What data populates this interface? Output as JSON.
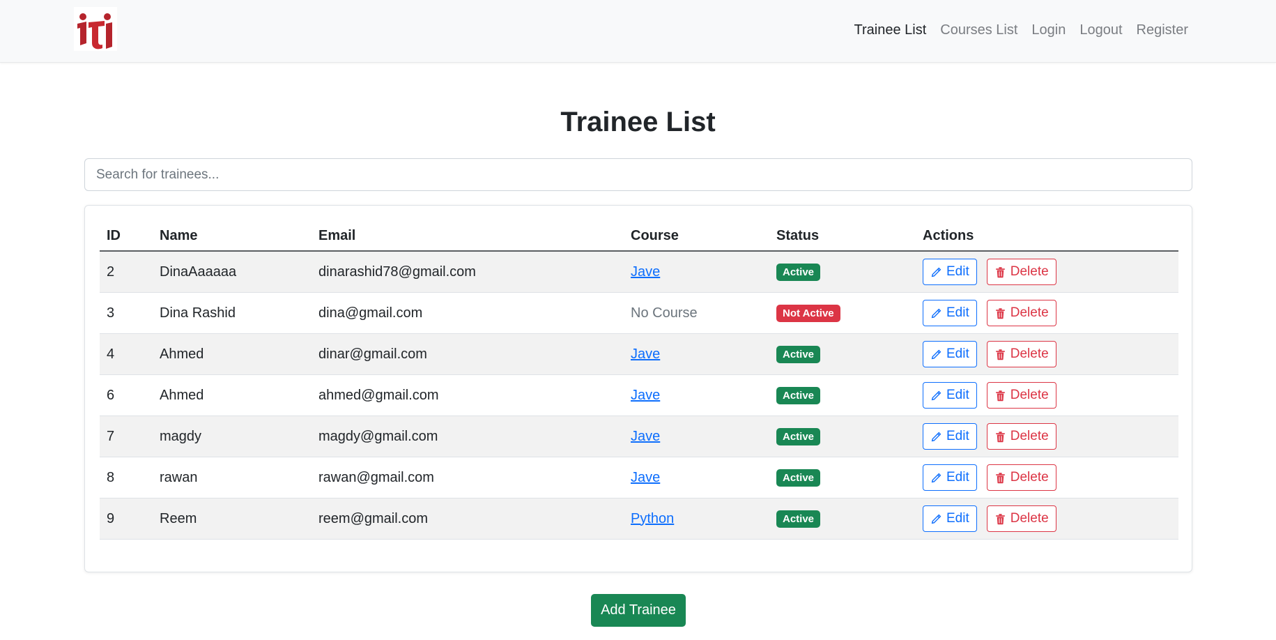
{
  "navbar": {
    "links": [
      {
        "label": "Trainee List",
        "active": true
      },
      {
        "label": "Courses List",
        "active": false
      },
      {
        "label": "Login",
        "active": false
      },
      {
        "label": "Logout",
        "active": false
      },
      {
        "label": "Register",
        "active": false
      }
    ]
  },
  "page": {
    "title": "Trainee List"
  },
  "search": {
    "placeholder": "Search for trainees..."
  },
  "table": {
    "headers": {
      "id": "ID",
      "name": "Name",
      "email": "Email",
      "course": "Course",
      "status": "Status",
      "actions": "Actions"
    },
    "rows": [
      {
        "id": "2",
        "name": "DinaAaaaaa",
        "email": "dinarashid78@gmail.com",
        "course": "Jave",
        "status": "Active"
      },
      {
        "id": "3",
        "name": "Dina Rashid",
        "email": "dina@gmail.com",
        "course": "No Course",
        "status": "Not Active"
      },
      {
        "id": "4",
        "name": "Ahmed",
        "email": "dinar@gmail.com",
        "course": "Jave",
        "status": "Active"
      },
      {
        "id": "6",
        "name": "Ahmed",
        "email": "ahmed@gmail.com",
        "course": "Jave",
        "status": "Active"
      },
      {
        "id": "7",
        "name": "magdy",
        "email": "magdy@gmail.com",
        "course": "Jave",
        "status": "Active"
      },
      {
        "id": "8",
        "name": "rawan",
        "email": "rawan@gmail.com",
        "course": "Jave",
        "status": "Active"
      },
      {
        "id": "9",
        "name": "Reem",
        "email": "reem@gmail.com",
        "course": "Python",
        "status": "Active"
      }
    ],
    "edit_label": "Edit",
    "delete_label": "Delete"
  },
  "add_button": {
    "label": "Add Trainee"
  },
  "colors": {
    "primary": "#0d6efd",
    "success": "#198754",
    "danger": "#dc3545",
    "logo_red": "#b5242c"
  },
  "icons": {
    "edit": "pencil-icon",
    "delete": "trash-icon",
    "logo": "iti-logo"
  }
}
